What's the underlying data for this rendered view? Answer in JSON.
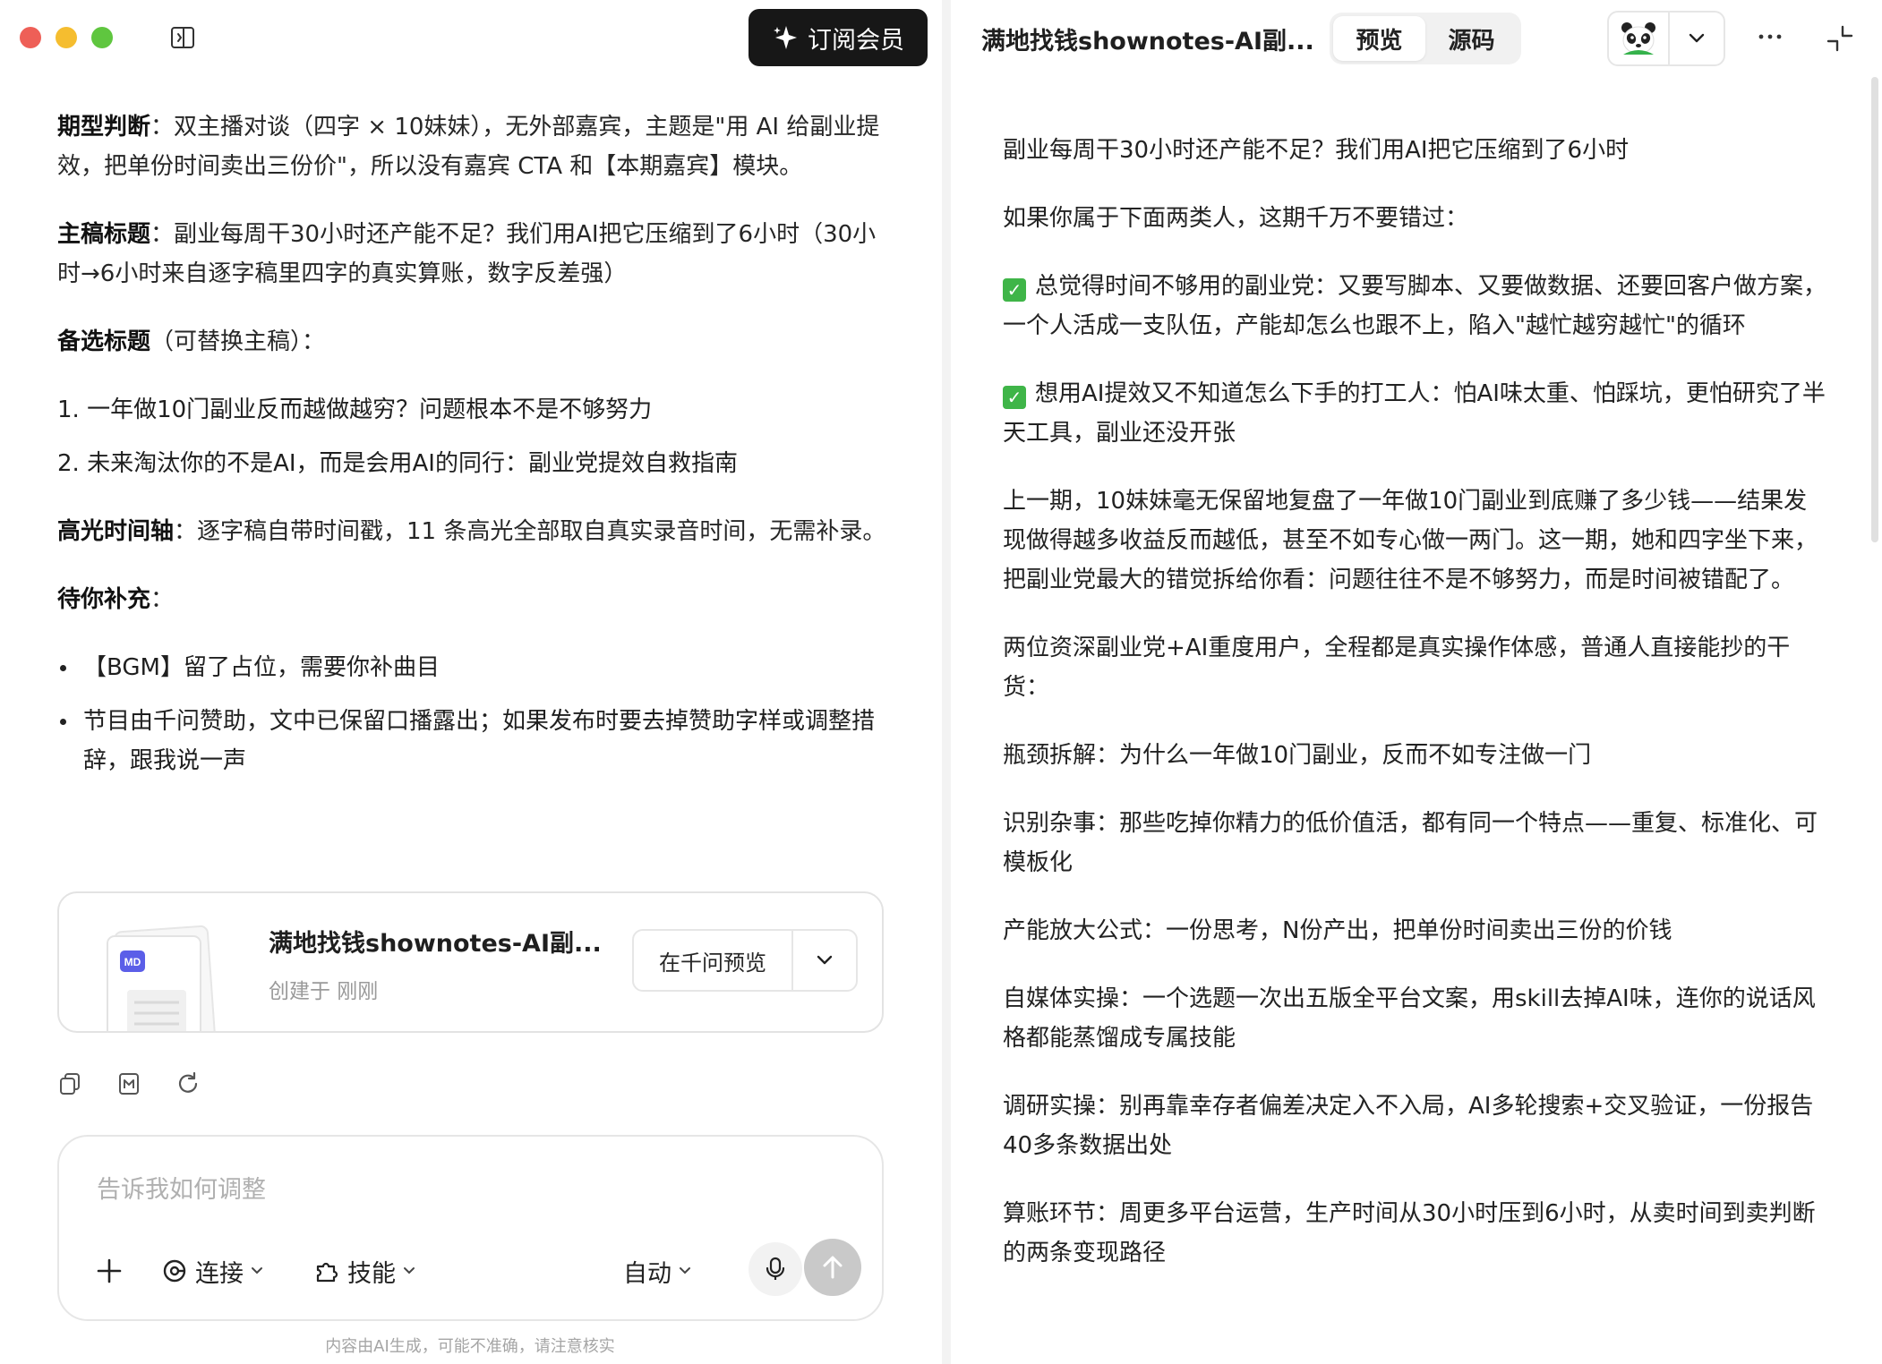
{
  "window": {
    "subscribe_label": "订阅会员"
  },
  "left": {
    "p1": {
      "label": "期型判断",
      "text": "：双主播对谈（四字 × 10妹妹），无外部嘉宾，主题是\"用 AI 给副业提效，把单份时间卖出三份价\"，所以没有嘉宾 CTA 和【本期嘉宾】模块。"
    },
    "p2": {
      "label": "主稿标题",
      "text": "：副业每周干30小时还产能不足？我们用AI把它压缩到了6小时（30小时→6小时来自逐字稿里四字的真实算账，数字反差强）"
    },
    "p3": {
      "label": "备选标题",
      "text": "（可替换主稿）："
    },
    "alt_titles": [
      "1. 一年做10门副业反而越做越穷？问题根本不是不够努力",
      "2. 未来淘汰你的不是AI，而是会用AI的同行：副业党提效自救指南"
    ],
    "p4": {
      "label": "高光时间轴",
      "text": "：逐字稿自带时间戳，11 条高光全部取自真实录音时间，无需补录。"
    },
    "p5": {
      "label": "待你补充",
      "text": "："
    },
    "todo": [
      "【BGM】留了占位，需要你补曲目",
      "节目由千问赞助，文中已保留口播露出；如果发布时要去掉赞助字样或调整措辞，跟我说一声"
    ]
  },
  "file_card": {
    "badge": "MD",
    "name": "满地找钱shownotes-AI副...",
    "meta": "创建于 刚刚",
    "preview_label": "在千问预览"
  },
  "composer": {
    "placeholder": "告诉我如何调整",
    "connect_label": "连接",
    "skill_label": "技能",
    "mode_label": "自动",
    "disclaimer": "内容由AI生成，可能不准确，请注意核实"
  },
  "right_header": {
    "doc_title": "满地找钱shownotes-AI副...",
    "tabs": [
      "预览",
      "源码"
    ]
  },
  "right": {
    "paragraphs": [
      "副业每周干30小时还产能不足？我们用AI把它压缩到了6小时",
      "如果你属于下面两类人，这期千万不要错过："
    ],
    "checks": [
      "总觉得时间不够用的副业党：又要写脚本、又要做数据、还要回客户做方案，一个人活成一支队伍，产能却怎么也跟不上，陷入\"越忙越穷越忙\"的循环",
      "想用AI提效又不知道怎么下手的打工人：怕AI味太重、怕踩坑，更怕研究了半天工具，副业还没开张"
    ],
    "body": [
      "上一期，10妹妹毫无保留地复盘了一年做10门副业到底赚了多少钱——结果发现做得越多收益反而越低，甚至不如专心做一两门。这一期，她和四字坐下来，把副业党最大的错觉拆给你看：问题往往不是不够努力，而是时间被错配了。",
      "两位资深副业党+AI重度用户，全程都是真实操作体感，普通人直接能抄的干货：",
      "瓶颈拆解：为什么一年做10门副业，反而不如专注做一门",
      "识别杂事：那些吃掉你精力的低价值活，都有同一个特点——重复、标准化、可模板化",
      "产能放大公式：一份思考，N份产出，把单份时间卖出三份的价钱",
      "自媒体实操：一个选题一次出五版全平台文案，用skill去掉AI味，连你的说话风格都能蒸馏成专属技能",
      "调研实操：别再靠幸存者偏差决定入不入局，AI多轮搜索+交叉验证，一份报告40多条数据出处",
      "算账环节：周更多平台运营，生产时间从30小时压到6小时，从卖时间到卖判断的两条变现路径"
    ]
  },
  "icons": {
    "sidebar": "sidebar-toggle-icon",
    "sparkle": "sparkle-icon",
    "copy": "copy-icon",
    "markdown": "markdown-icon",
    "regenerate": "refresh-icon",
    "plus": "plus-icon",
    "connect": "connect-icon",
    "skill": "puzzle-icon",
    "mic": "mic-icon",
    "send": "arrow-up-icon",
    "avatar": "panda-avatar",
    "more": "more-icon",
    "collapse": "collapse-icon"
  }
}
